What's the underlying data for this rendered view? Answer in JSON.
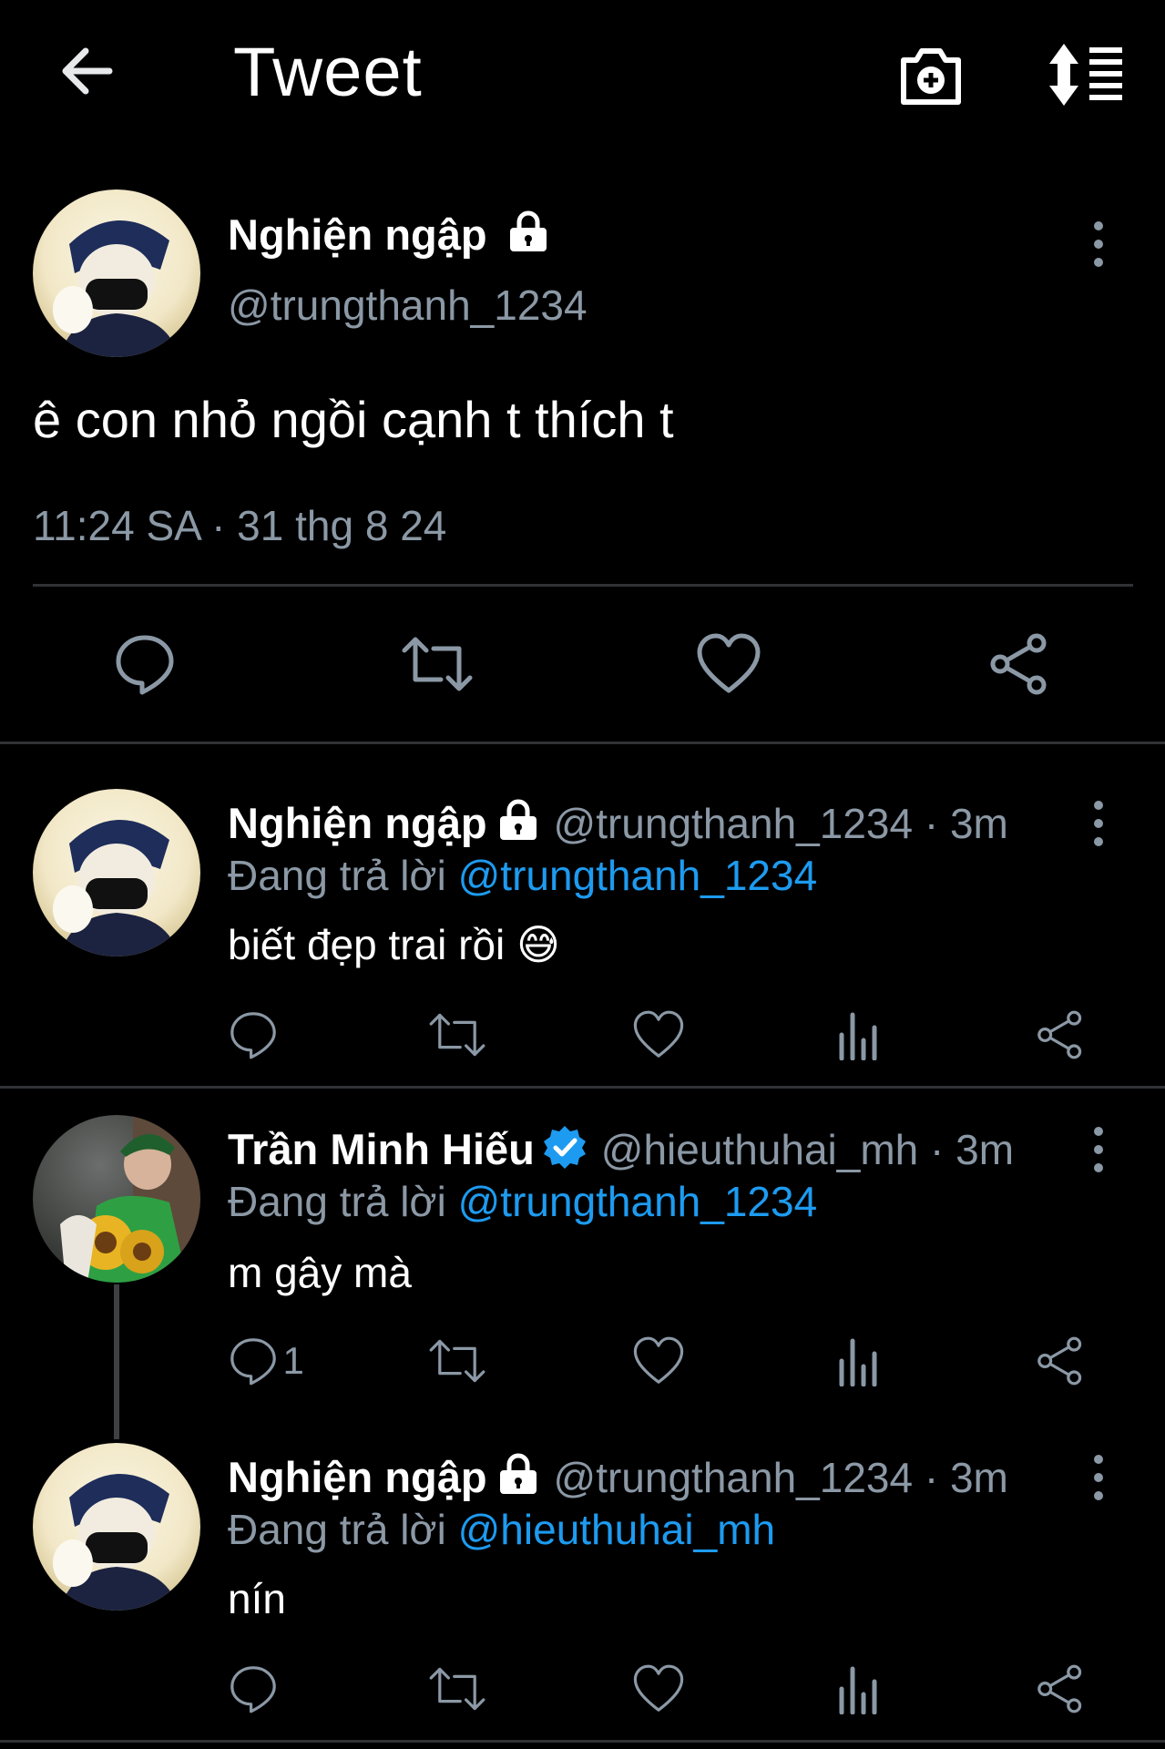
{
  "header": {
    "title": "Tweet",
    "back_icon": "arrow-left-icon",
    "camera_icon": "camera-plus-icon",
    "sort_icon": "sort-icon"
  },
  "main_tweet": {
    "display_name": "Nghiện ngập",
    "handle": "@trungthanh_1234",
    "text": "ê con nhỏ ngồi cạnh t thích t",
    "timestamp": "11:24 SA · 31 thg 8 24",
    "actions": [
      "reply",
      "retweet",
      "like",
      "share"
    ]
  },
  "replies": [
    {
      "display_name": "Nghiện ngập",
      "handle_time": "@trungthanh_1234 · 3m",
      "reply_prefix": "Đang trả lời",
      "reply_to": "@trungthanh_1234",
      "text": "biết đẹp trai rồi 😅",
      "reply_count": ""
    },
    {
      "display_name": "Trần Minh Hiếu",
      "handle_time": "@hieuthuhai_mh · 3m",
      "reply_prefix": "Đang trả lời",
      "reply_to": "@trungthanh_1234",
      "text": "m gây mà",
      "reply_count": "1"
    },
    {
      "display_name": "Nghiện ngập",
      "handle_time": "@trungthanh_1234 · 3m",
      "reply_prefix": "Đang trả lời",
      "reply_to": "@hieuthuhai_mh",
      "text": "nín",
      "reply_count": ""
    }
  ],
  "colors": {
    "background": "#000000",
    "text": "#ffffff",
    "secondary": "#8b98a5",
    "link": "#1d9bf0",
    "verified": "#1d9bf0",
    "divider": "#2f3336"
  }
}
